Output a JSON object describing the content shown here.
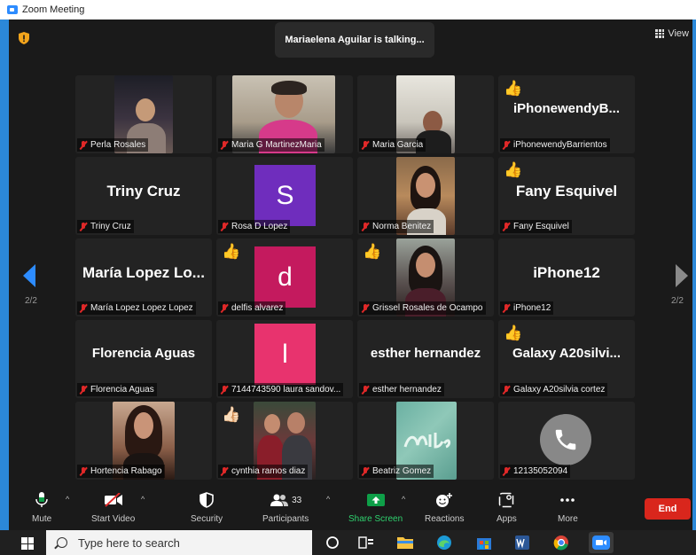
{
  "window": {
    "title": "Zoom Meeting"
  },
  "banner": {
    "talking": "Mariaelena Aguilar is talking..."
  },
  "view": {
    "label": "View"
  },
  "pager": {
    "left": "2/2",
    "right": "2/2"
  },
  "colors": {
    "accent": "#2d8cff",
    "end": "#d9261c",
    "mute_red": "#e02828",
    "share_green": "#0e9f48"
  },
  "tiles": [
    {
      "name": "Perla Rosales",
      "kind": "video",
      "reaction": ""
    },
    {
      "name": "Maria G MartinezMaria",
      "kind": "video",
      "reaction": ""
    },
    {
      "name": "Maria Garcia",
      "kind": "video",
      "reaction": ""
    },
    {
      "name": "iPhonewendyBarrientos",
      "kind": "text",
      "big": "iPhonewendyB...",
      "reaction": "thumbs-up"
    },
    {
      "name": "Triny Cruz",
      "kind": "text",
      "big": "Triny Cruz",
      "reaction": ""
    },
    {
      "name": "Rosa D Lopez",
      "kind": "initial",
      "initial": "S",
      "reaction": ""
    },
    {
      "name": "Norma Benitez",
      "kind": "video",
      "reaction": ""
    },
    {
      "name": "Fany Esquivel",
      "kind": "text",
      "big": "Fany Esquivel",
      "reaction": "thumbs-up"
    },
    {
      "name": "María  Lopez Lopez Lopez",
      "kind": "text",
      "big": "María  Lopez Lo...",
      "reaction": ""
    },
    {
      "name": "delfis alvarez",
      "kind": "initial",
      "initial": "d",
      "reaction": "thumbs-up"
    },
    {
      "name": "Grissel Rosales de Ocampo",
      "kind": "video",
      "reaction": "thumbs-up"
    },
    {
      "name": "iPhone12",
      "kind": "text",
      "big": "iPhone12",
      "reaction": ""
    },
    {
      "name": "Florencia Aguas",
      "kind": "text",
      "big": "Florencia Aguas",
      "reaction": ""
    },
    {
      "name": "7144743590 laura sandov...",
      "kind": "initial",
      "initial": "l",
      "reaction": ""
    },
    {
      "name": "esther hernandez",
      "kind": "text",
      "big": "esther hernandez",
      "reaction": ""
    },
    {
      "name": "Galaxy A20silvia cortez",
      "kind": "text",
      "big": "Galaxy  A20silvi...",
      "reaction": "thumbs-up"
    },
    {
      "name": "Hortencia Rabago",
      "kind": "video",
      "reaction": ""
    },
    {
      "name": "cynthia ramos diaz",
      "kind": "video",
      "reaction": "thumbs-up-light"
    },
    {
      "name": "Beatriz Gomez",
      "kind": "video",
      "reaction": ""
    },
    {
      "name": "12135052094",
      "kind": "phone",
      "reaction": ""
    }
  ],
  "toolbar": {
    "mute": "Mute",
    "start_video": "Start Video",
    "security": "Security",
    "participants": "Participants",
    "participants_count": "33",
    "share_screen": "Share Screen",
    "reactions": "Reactions",
    "apps": "Apps",
    "more": "More",
    "end": "End"
  },
  "taskbar": {
    "search_placeholder": "Type here to search"
  }
}
